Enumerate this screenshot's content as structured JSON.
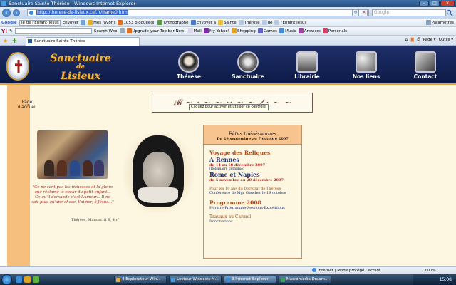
{
  "window": {
    "title": "Sanctuaire Sainte Thérèse - Windows Internet Explorer"
  },
  "address_bar": {
    "url": "http://therese-de-lisieux.cef.fr/frame0.htm",
    "search_placeholder": "Google"
  },
  "google_toolbar": {
    "brand": "Google",
    "search_value": "se de l'Enfant-Jésus",
    "send_label": "Envoyer",
    "favorites_label": "Mes favoris",
    "blocked_label": "1053 bloquée(s)",
    "spell_label": "Orthographe",
    "send_to_label": "Envoyer à",
    "words": [
      "Sainte",
      "Thérèse",
      "de",
      "l'Enfant Jésus"
    ],
    "settings_label": "Paramètres"
  },
  "yahoo_toolbar": {
    "brand": "Y!",
    "search_button": "Search Web",
    "upgrade_label": "Upgrade your Toolbar Now!",
    "mail_label": "Mail",
    "my_yahoo_label": "My Yahoo!",
    "shopping_label": "Shopping",
    "games_label": "Games",
    "music_label": "Music",
    "answers_label": "Answers",
    "personals_label": "Personals"
  },
  "tabs": {
    "active_tab": "Sanctuaire Sainte Thérèse",
    "page_menu": "Page",
    "tools_menu": "Outils"
  },
  "site": {
    "title_line1": "Sanctuaire",
    "title_line2": "de",
    "title_line3": "Lisieux",
    "nav": [
      {
        "label": "Thérèse"
      },
      {
        "label": "Sanctuaire"
      },
      {
        "label": "Librairie"
      },
      {
        "label": "Nos liens"
      },
      {
        "label": "Contact"
      }
    ],
    "sidebar_link": "Page d'accueil",
    "tooltip": "Cliquez pour activer et utiliser ce contrôle.",
    "quote": "\"Ce ne sont pas les richesses et la gloire que réclame le coeur du petit enfant... Ce qu'il demande c'est l'Amour... Il ne sait plus qu'une chose, t'aimer, ô Jésus...\"",
    "quote_source": "Thérèse, Manuscrit B, 4 r°"
  },
  "fetes": {
    "title": "Fêtes thérésiennes",
    "dates": "Du 29 septembre au 7 octobre 2007",
    "sections": {
      "voyage": "Voyage des Reliques",
      "rennes": "A Rennes",
      "rennes_dates": "du 14 au 18 décembre 2007",
      "rennes_note": "(Reliquaire gothique)",
      "rome": "Rome et Naples",
      "rome_dates": "du 5 novembre au 20 décembre 2007",
      "doctorat": "Pour les 10 ans du Doctorat de Thérèse",
      "conference": "Conférence de Mgr Gaucher le 19 octobre",
      "programme": "Programme 2008",
      "programme_desc": "Horaire-Programme-Sessions-Expositions",
      "travaux": "Travaux au Carmel",
      "informations": "Informations"
    }
  },
  "status_bar": {
    "zone": "Internet | Mode protégé : activé",
    "zoom": "100%"
  },
  "taskbar": {
    "buttons": [
      {
        "label": "4 Explorateur Win..."
      },
      {
        "label": "Lecteur Windows M..."
      },
      {
        "label": "3 Internet Explorer"
      },
      {
        "label": "Macromedia Dream..."
      }
    ],
    "clock": "15:08"
  }
}
